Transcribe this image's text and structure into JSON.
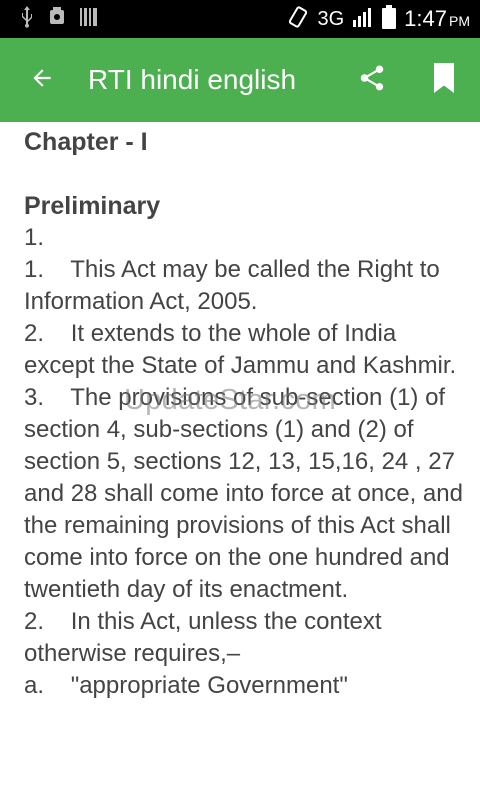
{
  "status_bar": {
    "network": "3G",
    "time": "1:47",
    "ampm": "PM",
    "icons": [
      "usb-icon",
      "notification-icon",
      "barcode-icon",
      "vibrate-icon",
      "signal-icon",
      "battery-icon"
    ]
  },
  "toolbar": {
    "title": "RTI hindi english",
    "back_icon": "arrow-back-icon",
    "share_icon": "share-icon",
    "bookmark_icon": "bookmark-icon",
    "background": "#4CAF50"
  },
  "document": {
    "chapter": "Chapter - I",
    "heading": "Preliminary",
    "lines": [
      "1.",
      "1.    This Act may be called the Right to Information Act, 2005.",
      "2.    It extends to the whole of India except the State of Jammu and Kashmir.",
      "3.    The provisions of sub-section (1) of section 4, sub-sections (1) and (2) of section 5, sections 12, 13, 15,16, 24 , 27 and 28 shall come into force at once, and the remaining provisions of this Act shall come into force on the one hundred and twentieth day of its enactment.",
      "2.    In this Act, unless the context otherwise requires,–",
      "a.    \"appropriate Government\""
    ]
  },
  "watermark": "UpdateStar.com"
}
